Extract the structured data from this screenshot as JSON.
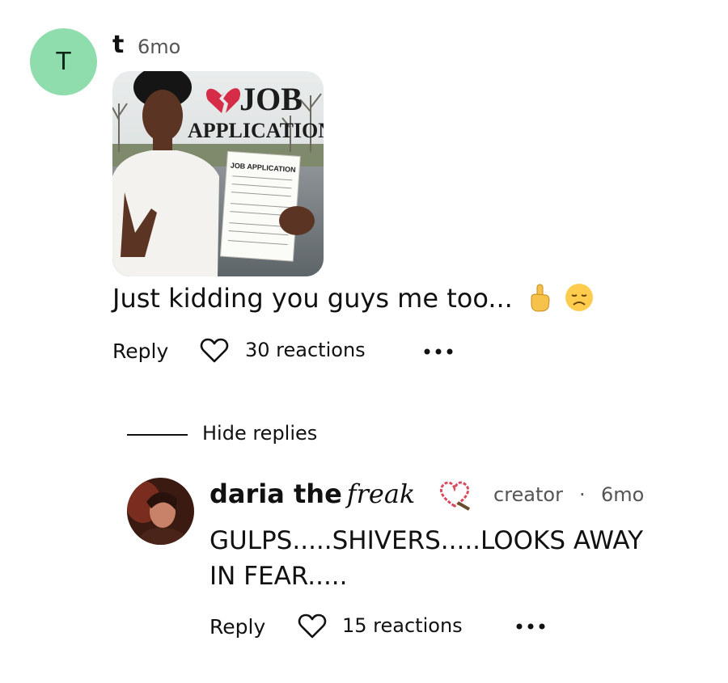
{
  "comment": {
    "avatar_letter": "T",
    "username": "t",
    "time": "6mo",
    "image": {
      "headline_line1": "JOB",
      "headline_line2": "APPLICATION",
      "paper_title": "JOB APPLICATION"
    },
    "text": "Just kidding you guys me too...",
    "emojis": [
      "pointing-up-emoji",
      "disappointed-face-emoji"
    ],
    "reply_label": "Reply",
    "reactions": "30 reactions"
  },
  "thread": {
    "hide_replies_label": "Hide replies"
  },
  "reply": {
    "username": "daria the",
    "username_fancy": "freak",
    "badge": "creator",
    "separator": "·",
    "time": "6mo",
    "text": "GULPS.....SHIVERS.....LOOKS AWAY IN FEAR.....",
    "reply_label": "Reply",
    "reactions": "15 reactions"
  },
  "colors": {
    "avatar_bg": "#8fdcad",
    "text": "#111111",
    "muted": "#555555"
  }
}
